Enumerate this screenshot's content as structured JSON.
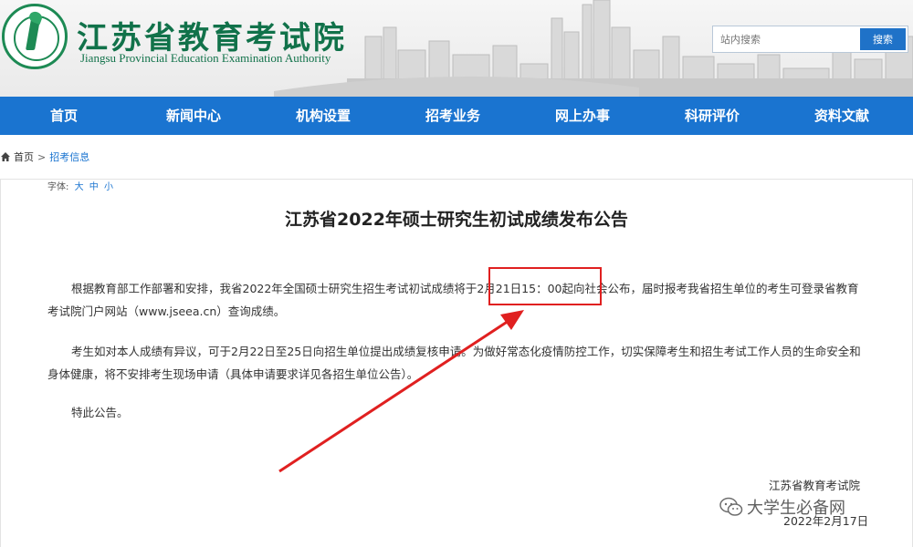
{
  "header": {
    "org_name_cn": "江苏省教育考试院",
    "org_name_en": "Jiangsu Provincial Education Examination Authority",
    "search": {
      "placeholder": "站内搜索",
      "button_label": "搜索"
    }
  },
  "nav": {
    "items": [
      "首页",
      "新闻中心",
      "机构设置",
      "招考业务",
      "网上办事",
      "科研评价",
      "资料文献"
    ]
  },
  "breadcrumb": {
    "home": "首页",
    "separator": ">",
    "current": "招考信息"
  },
  "font_size": {
    "label": "字体:",
    "options": [
      "大",
      "中",
      "小"
    ]
  },
  "article": {
    "title": "江苏省2022年硕士研究生初试成绩发布公告",
    "paragraphs": [
      "根据教育部工作部署和安排，我省2022年全国硕士研究生招生考试初试成绩将于2月21日15：00起向社会公布，届时报考我省招生单位的考生可登录省教育考试院门户网站（www.jseea.cn）查询成绩。",
      "考生如对本人成绩有异议，可于2月22日至25日向招生单位提出成绩复核申请。为做好常态化疫情防控工作，切实保障考生和招生考试工作人员的生命安全和身体健康，将不安排考生现场申请（具体申请要求详见各招生单位公告）。",
      "特此公告。"
    ],
    "signature": "江苏省教育考试院",
    "date": "2022年2月17日"
  },
  "watermark": {
    "text": "大学生必备网",
    "icon": "wechat-icon"
  },
  "colors": {
    "brand_green": "#11724a",
    "nav_blue": "#1a74d0",
    "highlight_red": "#e02020"
  }
}
